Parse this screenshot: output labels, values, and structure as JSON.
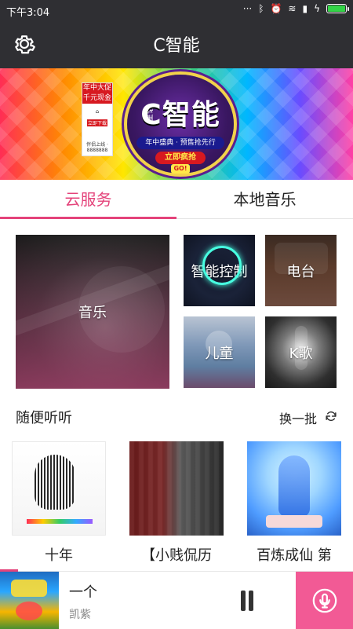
{
  "status_bar": {
    "time": "下午3:04",
    "icons": [
      "more-dots-icon",
      "bluetooth-icon",
      "alarm-icon",
      "wifi-icon",
      "signal-icon",
      "charging-icon",
      "battery-icon"
    ],
    "battery_level_percent": 100
  },
  "header": {
    "title": "C智能",
    "settings_icon": "gear-icon"
  },
  "banner": {
    "card_text_top": "年中大促",
    "card_text_sub": "千元现金券",
    "card_tag": "立即下载",
    "card_small": "伴侣上线 · 8888888",
    "badge_big": "C智能",
    "badge_side": "星语",
    "badge_strip": "年中盛典 · 预售抢先行",
    "badge_buy": "立即疯抢",
    "badge_go": "GO!"
  },
  "tabs": [
    {
      "label": "云服务",
      "active": true
    },
    {
      "label": "本地音乐",
      "active": false
    }
  ],
  "tiles": {
    "music": "音乐",
    "smart_control": "智能控制",
    "radio": "电台",
    "kids": "儿童",
    "karaoke": "K歌"
  },
  "section": {
    "title": "随便听听",
    "refresh_label": "换一批",
    "refresh_icon": "refresh-icon"
  },
  "recommendations": [
    {
      "title": "十年"
    },
    {
      "title": "【小贱侃历"
    },
    {
      "title": "百炼成仙 第"
    }
  ],
  "player": {
    "song": "一个",
    "artist": "凯紫",
    "progress_fraction": 0.05,
    "pause_icon": "pause-icon",
    "mic_icon": "mic-icon"
  },
  "colors": {
    "accent": "#e4437a",
    "header_bg": "#2f2f33",
    "mic_bg": "#f25a95"
  }
}
